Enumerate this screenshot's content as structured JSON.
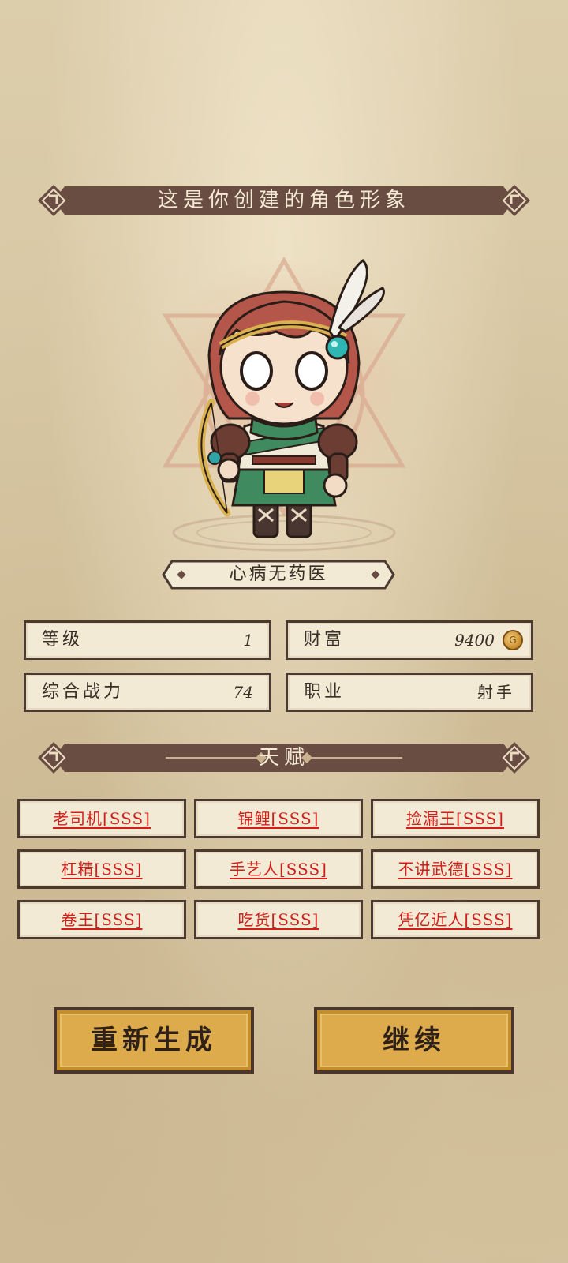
{
  "header": {
    "title": "这是你创建的角色形象"
  },
  "character": {
    "name": "心病无药医"
  },
  "stats": {
    "level_label": "等级",
    "level_value": "1",
    "wealth_label": "财富",
    "wealth_value": "9400",
    "wealth_icon": "gold-coin-icon",
    "power_label": "综合战力",
    "power_value": "74",
    "job_label": "职业",
    "job_value": "射手"
  },
  "talents": {
    "title": "天赋",
    "items": [
      "老司机[SSS]",
      "锦鲤[SSS]",
      "捡漏王[SSS]",
      "杠精[SSS]",
      "手艺人[SSS]",
      "不讲武德[SSS]",
      "卷王[SSS]",
      "吃货[SSS]",
      "凭亿近人[SSS]"
    ]
  },
  "actions": {
    "regenerate": "重新生成",
    "continue": "继续"
  },
  "colors": {
    "banner": "#6a4d42",
    "talent_text": "#d21f1a",
    "button": "#ddab4c",
    "parchment": "#dccdab"
  }
}
